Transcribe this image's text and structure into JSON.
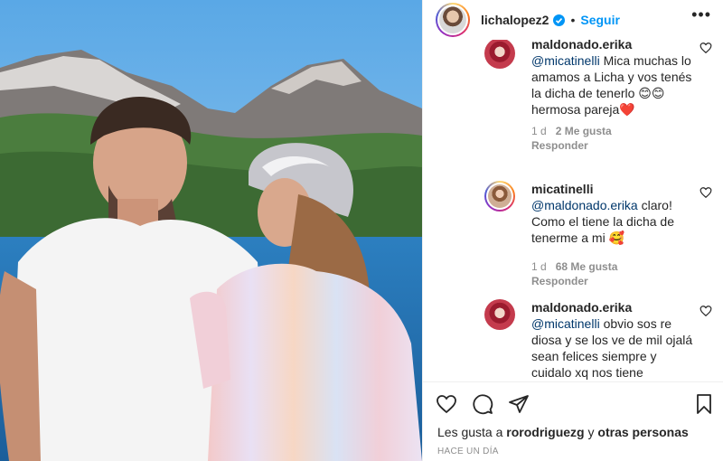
{
  "header": {
    "username": "lichalopez2",
    "separator": "•",
    "follow_label": "Seguir",
    "more_label": "•••"
  },
  "comments": [
    {
      "user": "maldonado.erika",
      "mention": "@micatinelli",
      "text": " Mica muchas lo amamos a Licha y vos tenés la dicha de tenerlo 😊😊 hermosa pareja❤️",
      "age": "1 d",
      "likes": "2 Me gusta",
      "reply": "Responder"
    },
    {
      "user": "micatinelli",
      "mention": "@maldonado.erika",
      "text": " claro! Como el tiene la dicha de tenerme a mi 🥰",
      "age": "1 d",
      "likes": "68 Me gusta",
      "reply": "Responder"
    },
    {
      "user": "maldonado.erika",
      "mention": "@micatinelli",
      "text": " obvio sos re diosa y se los ve de mil ojalá sean felices siempre y cuidalo xq nos tiene",
      "age": "",
      "likes": "",
      "reply": ""
    }
  ],
  "footer": {
    "likes_prefix": "Les gusta a ",
    "likes_user": "rorodriguezg",
    "likes_middle": " y ",
    "likes_others": "otras personas",
    "time": "HACE UN DÍA"
  },
  "colors": {
    "accent": "#0095f6",
    "mention": "#00376b",
    "muted": "#8e8e8e",
    "text": "#262626"
  },
  "icons": [
    "verified-badge-icon",
    "more-options-icon",
    "heart-icon",
    "comment-icon",
    "share-icon",
    "bookmark-icon"
  ]
}
